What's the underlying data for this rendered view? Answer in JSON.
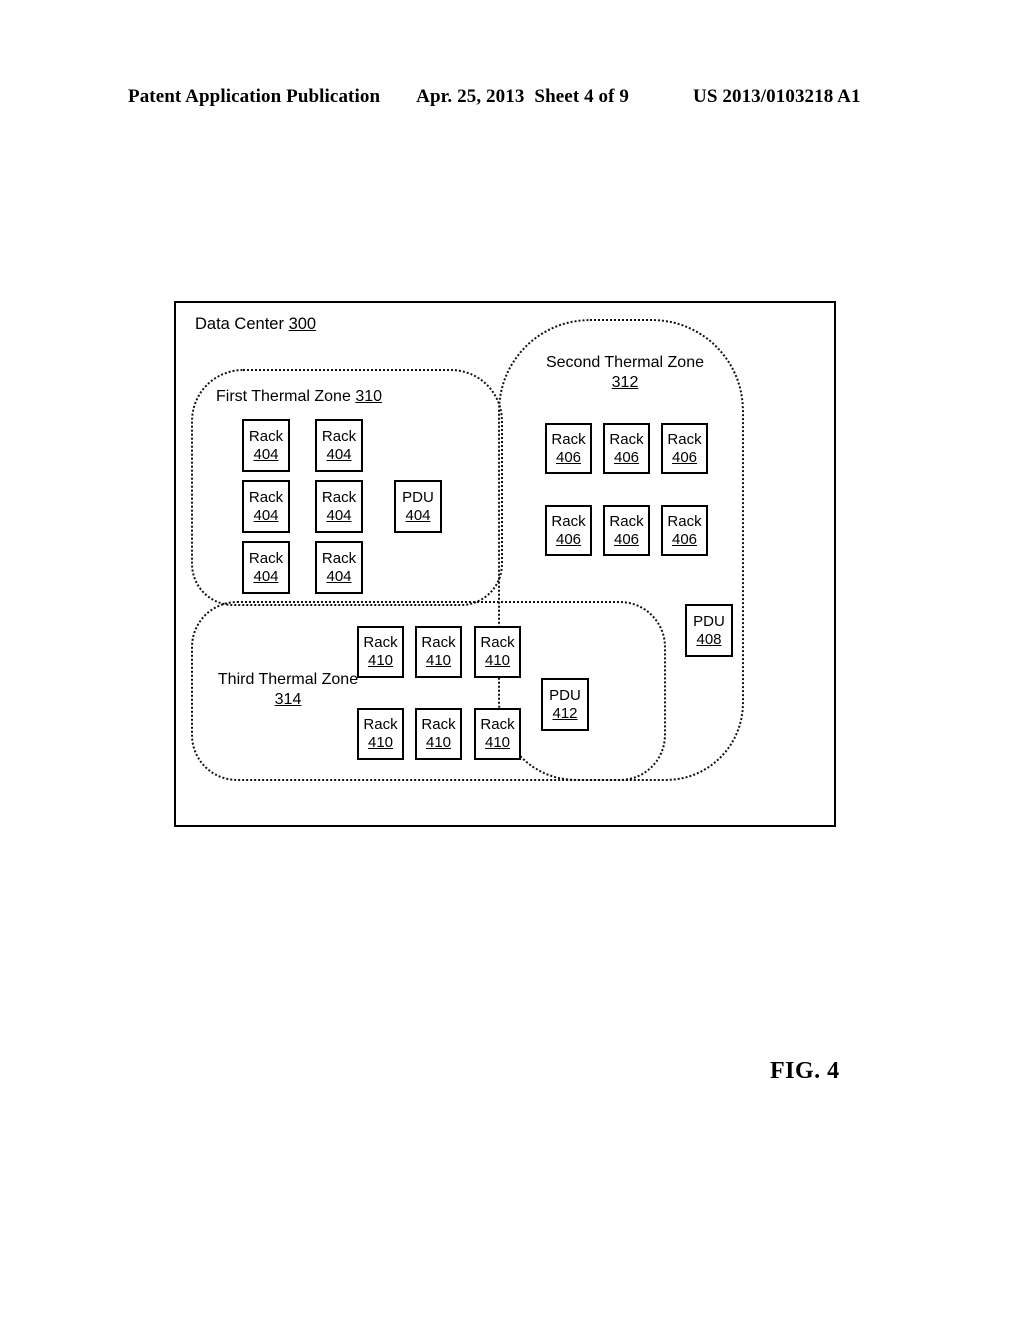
{
  "header": {
    "publication": "Patent Application Publication",
    "date": "Apr. 25, 2013",
    "sheet": "Sheet 4 of 9",
    "number": "US 2013/0103218 A1"
  },
  "figure": {
    "caption": "FIG. 4"
  },
  "diagram": {
    "container": {
      "label": "Data Center",
      "ref": "300"
    },
    "zones": [
      {
        "id": "zone1",
        "label": "First Thermal Zone",
        "ref": "310",
        "label_lines": [
          "First Thermal Zone 310"
        ]
      },
      {
        "id": "zone2",
        "label": "Second Thermal Zone",
        "ref": "312",
        "label_lines": [
          "Second Thermal Zone",
          "312"
        ]
      },
      {
        "id": "zone3",
        "label": "Third Thermal Zone",
        "ref": "314",
        "label_lines": [
          "Third Thermal Zone",
          "314"
        ]
      }
    ],
    "units": {
      "zone1_racks": [
        {
          "name": "Rack",
          "ref": "404"
        },
        {
          "name": "Rack",
          "ref": "404"
        },
        {
          "name": "Rack",
          "ref": "404"
        },
        {
          "name": "Rack",
          "ref": "404"
        },
        {
          "name": "Rack",
          "ref": "404"
        },
        {
          "name": "Rack",
          "ref": "404"
        }
      ],
      "zone1_pdu": {
        "name": "PDU",
        "ref": "404"
      },
      "zone2_racks": [
        {
          "name": "Rack",
          "ref": "406"
        },
        {
          "name": "Rack",
          "ref": "406"
        },
        {
          "name": "Rack",
          "ref": "406"
        },
        {
          "name": "Rack",
          "ref": "406"
        },
        {
          "name": "Rack",
          "ref": "406"
        },
        {
          "name": "Rack",
          "ref": "406"
        }
      ],
      "zone2_pdu": {
        "name": "PDU",
        "ref": "408"
      },
      "zone3_racks": [
        {
          "name": "Rack",
          "ref": "410"
        },
        {
          "name": "Rack",
          "ref": "410"
        },
        {
          "name": "Rack",
          "ref": "410"
        },
        {
          "name": "Rack",
          "ref": "410"
        },
        {
          "name": "Rack",
          "ref": "410"
        },
        {
          "name": "Rack",
          "ref": "410"
        }
      ],
      "zone3_pdu": {
        "name": "PDU",
        "ref": "412"
      }
    }
  }
}
